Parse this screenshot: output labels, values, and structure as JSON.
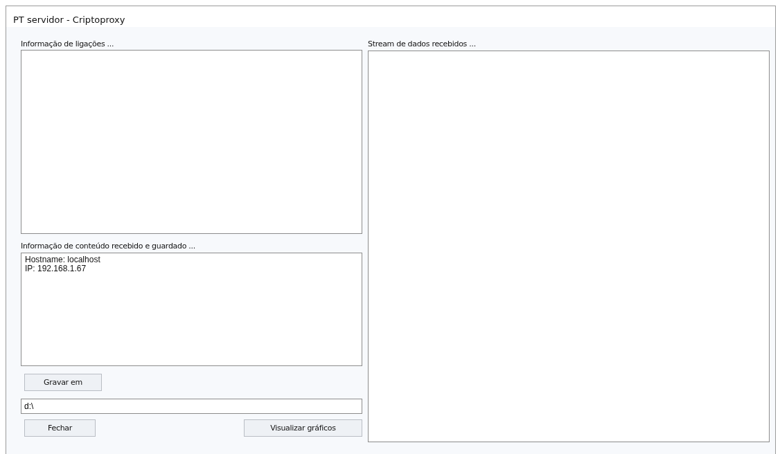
{
  "window": {
    "title": "PT servidor - Criptoproxy"
  },
  "connections": {
    "label": "Informação de ligações ..."
  },
  "content": {
    "label": "Informação de conteúdo recebido e guardado ...",
    "lines": [
      "Hostname: localhost",
      "IP: 192.168.1.67"
    ]
  },
  "save_button": "Gravar em",
  "path_field": {
    "value": "d:\\"
  },
  "buttons": [
    "Fechar",
    "Visualizar gráficos"
  ],
  "stream": {
    "label": "Stream de dados recebidos ..."
  }
}
